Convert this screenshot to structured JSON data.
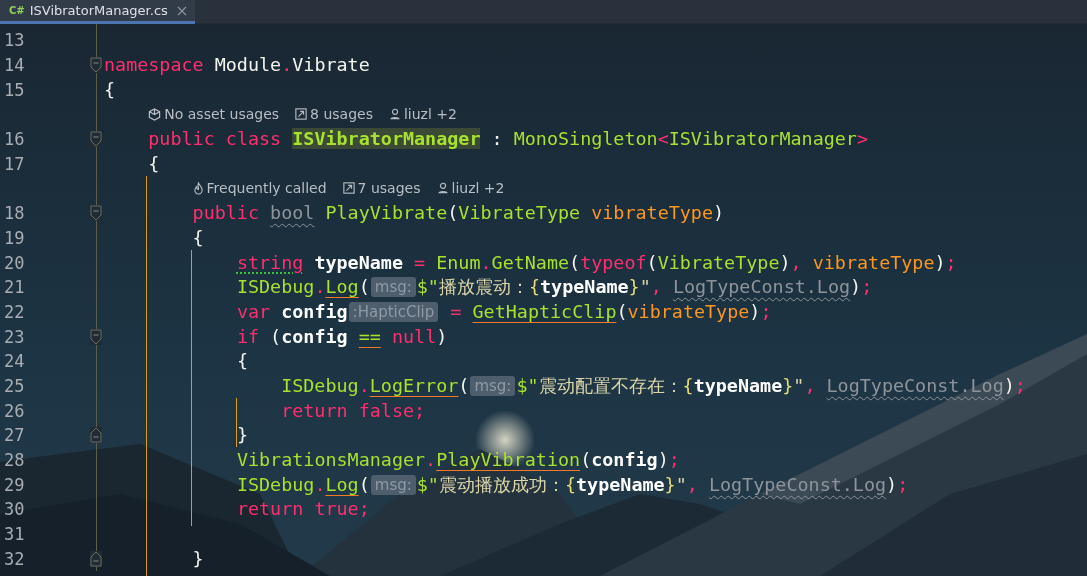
{
  "tab": {
    "icon_label": "C#",
    "label": "ISVibratorManager.cs",
    "selected": true
  },
  "lines": [
    {
      "kind": "code",
      "number": "13",
      "fold_start": false,
      "fold_end": false
    },
    {
      "kind": "code",
      "number": "14",
      "fold_start": true,
      "fold_end": false,
      "tokens": [
        {
          "text": "namespace",
          "kind": "keyword"
        },
        {
          "text": " Module",
          "kind": "plain"
        },
        {
          "text": ".",
          "kind": "punct"
        },
        {
          "text": "Vibrate",
          "kind": "plain"
        }
      ]
    },
    {
      "kind": "code",
      "number": "15",
      "fold_start": false,
      "fold_end": false,
      "tokens": [
        {
          "text": "{",
          "kind": "plain"
        }
      ]
    },
    {
      "kind": "lens",
      "items": [
        {
          "kind": "asset",
          "text": "No asset usages"
        },
        {
          "kind": "usages",
          "text": "8 usages"
        },
        {
          "kind": "author",
          "text": "liuzl +2"
        }
      ]
    },
    {
      "kind": "code",
      "number": "16",
      "fold_start": true,
      "fold_end": false,
      "tokens": [
        {
          "text": "    public",
          "kind": "keyword"
        },
        {
          "text": " class ",
          "kind": "keyword"
        },
        {
          "text": "ISVibratorManager",
          "kind": "highlight"
        },
        {
          "text": " : ",
          "kind": "plain"
        },
        {
          "text": "MonoSingleton",
          "kind": "type"
        },
        {
          "text": "<",
          "kind": "punct"
        },
        {
          "text": "ISVibratorManager",
          "kind": "type"
        },
        {
          "text": ">",
          "kind": "punct"
        }
      ]
    },
    {
      "kind": "code",
      "number": "17",
      "fold_start": false,
      "fold_end": false,
      "tokens": [
        {
          "text": "    {",
          "kind": "plain"
        }
      ]
    },
    {
      "kind": "lens",
      "items": [
        {
          "kind": "frequency",
          "text": "Frequently called"
        },
        {
          "kind": "usages",
          "text": "7 usages"
        },
        {
          "kind": "author",
          "text": "liuzl +2"
        }
      ]
    },
    {
      "kind": "code",
      "number": "18",
      "fold_start": true,
      "fold_end": false,
      "tokens": [
        {
          "text": "        public ",
          "kind": "keyword"
        },
        {
          "text": "bool",
          "kind": "weak"
        },
        {
          "text": " PlayVibrate",
          "kind": "type"
        },
        {
          "text": "(",
          "kind": "plain"
        },
        {
          "text": "VibrateType",
          "kind": "type"
        },
        {
          "text": " vibrateType",
          "kind": "param"
        },
        {
          "text": ")",
          "kind": "plain"
        }
      ]
    },
    {
      "kind": "code",
      "number": "19",
      "fold_start": false,
      "fold_end": false,
      "tokens": [
        {
          "text": "        {",
          "kind": "plain"
        }
      ]
    },
    {
      "kind": "code",
      "number": "20",
      "fold_start": false,
      "fold_end": false,
      "tokens": [
        {
          "text": "            string",
          "kind": "typo"
        },
        {
          "text": " typeName",
          "kind": "ident"
        },
        {
          "text": " = ",
          "kind": "punct"
        },
        {
          "text": "Enum",
          "kind": "type"
        },
        {
          "text": ".",
          "kind": "punct"
        },
        {
          "text": "GetName",
          "kind": "type"
        },
        {
          "text": "(",
          "kind": "plain"
        },
        {
          "text": "typeof",
          "kind": "keyword"
        },
        {
          "text": "(",
          "kind": "plain"
        },
        {
          "text": "VibrateType",
          "kind": "type"
        },
        {
          "text": ")",
          "kind": "plain"
        },
        {
          "text": ", ",
          "kind": "punct"
        },
        {
          "text": "vibrateType",
          "kind": "param"
        },
        {
          "text": ")",
          "kind": "plain"
        },
        {
          "text": ";",
          "kind": "punct"
        }
      ]
    },
    {
      "kind": "code",
      "number": "21",
      "fold_start": false,
      "fold_end": false,
      "tokens": [
        {
          "text": "            ISDebug",
          "kind": "type"
        },
        {
          "text": ".",
          "kind": "punct"
        },
        {
          "text": "Log",
          "kind": "warned"
        },
        {
          "text": "(",
          "kind": "plain"
        },
        {
          "text": "msg:",
          "kind": "hint"
        },
        {
          "text": "$\"",
          "kind": "type"
        },
        {
          "text": "播放震动：",
          "kind": "string"
        },
        {
          "text": "{",
          "kind": "brace"
        },
        {
          "text": "typeName",
          "kind": "ident"
        },
        {
          "text": "}",
          "kind": "brace"
        },
        {
          "text": "\"",
          "kind": "string"
        },
        {
          "text": ", ",
          "kind": "punct"
        },
        {
          "text": "LogTypeConst.Log",
          "kind": "weak"
        },
        {
          "text": ")",
          "kind": "plain"
        },
        {
          "text": ";",
          "kind": "punct"
        }
      ]
    },
    {
      "kind": "code",
      "number": "22",
      "fold_start": false,
      "fold_end": false,
      "tokens": [
        {
          "text": "            var",
          "kind": "keyword"
        },
        {
          "text": " config",
          "kind": "ident"
        },
        {
          "text": ":HapticClip",
          "kind": "hint"
        },
        {
          "text": " = ",
          "kind": "punct"
        },
        {
          "text": "GetHapticClip",
          "kind": "warned"
        },
        {
          "text": "(",
          "kind": "plain"
        },
        {
          "text": "vibrateType",
          "kind": "param"
        },
        {
          "text": ")",
          "kind": "plain"
        },
        {
          "text": ";",
          "kind": "punct"
        }
      ]
    },
    {
      "kind": "code",
      "number": "23",
      "fold_start": true,
      "fold_end": false,
      "tokens": [
        {
          "text": "            if",
          "kind": "keyword"
        },
        {
          "text": " (",
          "kind": "plain"
        },
        {
          "text": "config ",
          "kind": "ident"
        },
        {
          "text": "==",
          "kind": "warned"
        },
        {
          "text": " null",
          "kind": "keyword"
        },
        {
          "text": ")",
          "kind": "plain"
        }
      ]
    },
    {
      "kind": "code",
      "number": "24",
      "fold_start": false,
      "fold_end": false,
      "tokens": [
        {
          "text": "            {",
          "kind": "plain"
        }
      ]
    },
    {
      "kind": "code",
      "number": "25",
      "fold_start": false,
      "fold_end": false,
      "tokens": [
        {
          "text": "                ISDebug",
          "kind": "type"
        },
        {
          "text": ".",
          "kind": "punct"
        },
        {
          "text": "LogError",
          "kind": "warned"
        },
        {
          "text": "(",
          "kind": "plain"
        },
        {
          "text": "msg:",
          "kind": "hint"
        },
        {
          "text": "$\"",
          "kind": "type"
        },
        {
          "text": "震动配置不存在：",
          "kind": "string"
        },
        {
          "text": "{",
          "kind": "brace"
        },
        {
          "text": "typeName",
          "kind": "ident"
        },
        {
          "text": "}",
          "kind": "brace"
        },
        {
          "text": "\"",
          "kind": "string"
        },
        {
          "text": ", ",
          "kind": "punct"
        },
        {
          "text": "LogTypeConst.Log",
          "kind": "weak"
        },
        {
          "text": ")",
          "kind": "plain"
        },
        {
          "text": ";",
          "kind": "punct"
        }
      ]
    },
    {
      "kind": "code",
      "number": "26",
      "fold_start": false,
      "fold_end": false,
      "tokens": [
        {
          "text": "                return",
          "kind": "keyword"
        },
        {
          "text": " false",
          "kind": "keyword"
        },
        {
          "text": ";",
          "kind": "punct"
        }
      ]
    },
    {
      "kind": "code",
      "number": "27",
      "fold_start": false,
      "fold_end": true,
      "tokens": [
        {
          "text": "            }",
          "kind": "plain"
        }
      ]
    },
    {
      "kind": "code",
      "number": "28",
      "fold_start": false,
      "fold_end": false,
      "tokens": [
        {
          "text": "            VibrationsManager",
          "kind": "type"
        },
        {
          "text": ".",
          "kind": "punct"
        },
        {
          "text": "PlayVibration",
          "kind": "warned"
        },
        {
          "text": "(",
          "kind": "plain"
        },
        {
          "text": "config",
          "kind": "ident"
        },
        {
          "text": ")",
          "kind": "plain"
        },
        {
          "text": ";",
          "kind": "punct"
        }
      ]
    },
    {
      "kind": "code",
      "number": "29",
      "fold_start": false,
      "fold_end": false,
      "tokens": [
        {
          "text": "            ISDebug",
          "kind": "type"
        },
        {
          "text": ".",
          "kind": "punct"
        },
        {
          "text": "Log",
          "kind": "warned"
        },
        {
          "text": "(",
          "kind": "plain"
        },
        {
          "text": "msg:",
          "kind": "hint"
        },
        {
          "text": "$\"",
          "kind": "type"
        },
        {
          "text": "震动播放成功：",
          "kind": "string"
        },
        {
          "text": "{",
          "kind": "brace"
        },
        {
          "text": "typeName",
          "kind": "ident"
        },
        {
          "text": "}",
          "kind": "brace"
        },
        {
          "text": "\"",
          "kind": "string"
        },
        {
          "text": ", ",
          "kind": "punct"
        },
        {
          "text": "LogTypeConst.Log",
          "kind": "weak"
        },
        {
          "text": ")",
          "kind": "plain"
        },
        {
          "text": ";",
          "kind": "punct"
        }
      ]
    },
    {
      "kind": "code",
      "number": "30",
      "fold_start": false,
      "fold_end": false,
      "tokens": [
        {
          "text": "            return",
          "kind": "keyword"
        },
        {
          "text": " true",
          "kind": "keyword"
        },
        {
          "text": ";",
          "kind": "punct"
        }
      ]
    },
    {
      "kind": "code",
      "number": "31",
      "fold_start": false,
      "fold_end": false
    },
    {
      "kind": "code",
      "number": "32",
      "fold_start": false,
      "fold_end": true,
      "tokens": [
        {
          "text": "        }",
          "kind": "plain"
        }
      ]
    }
  ]
}
